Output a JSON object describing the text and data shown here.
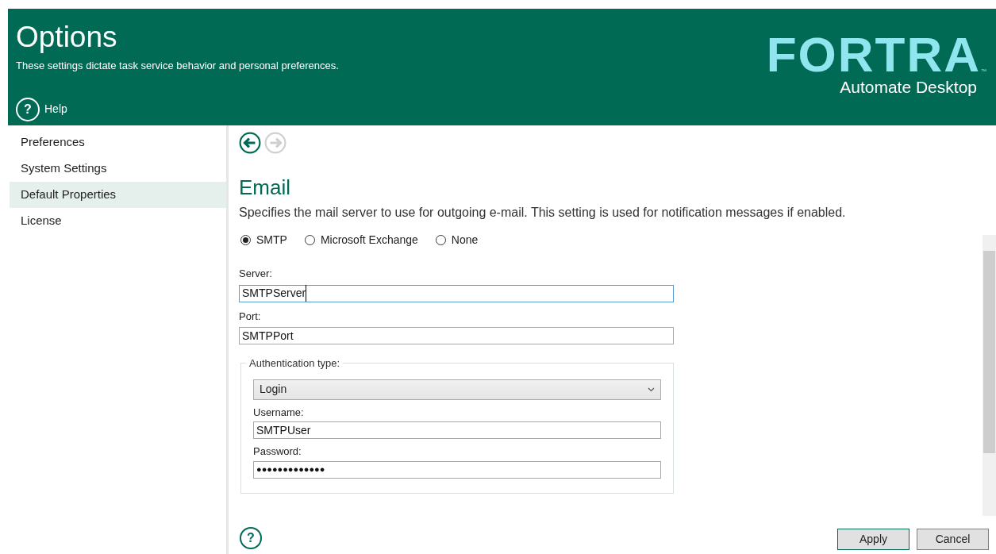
{
  "header": {
    "title": "Options",
    "subtitle": "These settings dictate task service behavior and personal preferences.",
    "help_label": "Help",
    "help_glyph": "?",
    "logo": {
      "wordmark": "FORTRA",
      "trademark": "™",
      "product": "Automate Desktop"
    }
  },
  "sidebar": {
    "items": [
      {
        "label": "Preferences",
        "selected": false
      },
      {
        "label": "System Settings",
        "selected": false
      },
      {
        "label": "Default Properties",
        "selected": true
      },
      {
        "label": "License",
        "selected": false
      }
    ]
  },
  "nav": {
    "back_disabled": false,
    "forward_disabled": true
  },
  "section": {
    "title": "Email",
    "description": "Specifies the mail server to use for outgoing e-mail. This setting is used for notification messages if enabled."
  },
  "mail_type": [
    {
      "label": "SMTP",
      "selected": true
    },
    {
      "label": "Microsoft Exchange",
      "selected": false
    },
    {
      "label": "None",
      "selected": false
    }
  ],
  "fields": [
    {
      "label": "Server:",
      "value": "SMTPServer",
      "focused": true
    },
    {
      "label": "Port:",
      "value": "SMTPPort",
      "focused": false
    }
  ],
  "authentication": {
    "legend": "Authentication type:",
    "dropdown": {
      "value": "Login"
    },
    "fields": [
      {
        "label": "Username:",
        "value": "SMTPUser",
        "kind": "text"
      },
      {
        "label": "Password:",
        "value": "●●●●●●●●●●●●●",
        "kind": "password"
      }
    ]
  },
  "footer": {
    "help_glyph": "?",
    "buttons": [
      {
        "label": "Apply",
        "default": true
      },
      {
        "label": "Cancel",
        "default": false
      }
    ]
  }
}
